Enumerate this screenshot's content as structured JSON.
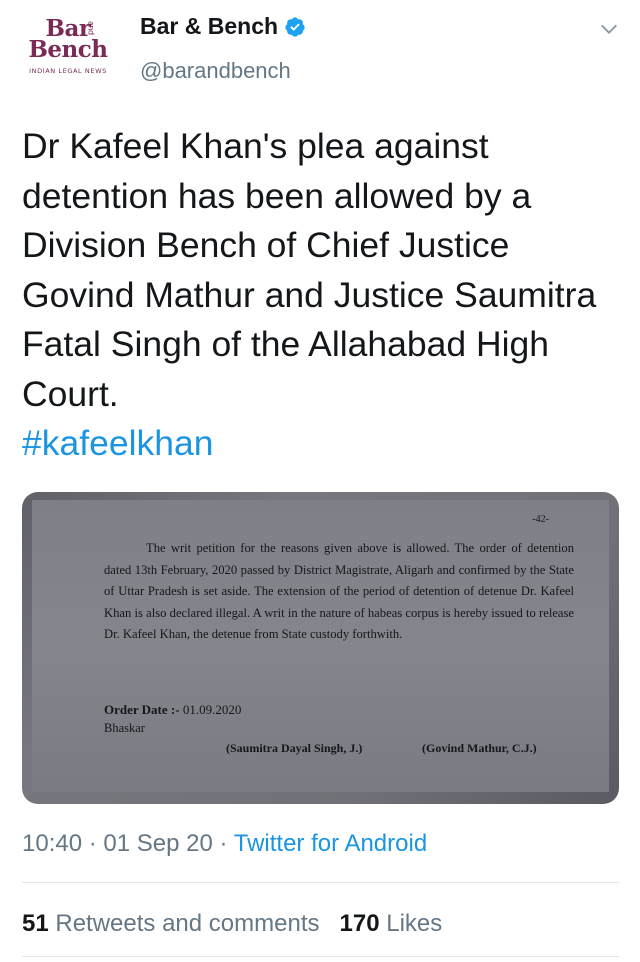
{
  "author": {
    "logo": {
      "line1": "Bar",
      "line2": "Bench",
      "and": "and",
      "tagline": "INDIAN LEGAL NEWS"
    },
    "display_name": "Bar & Bench",
    "handle": "@barandbench"
  },
  "tweet": {
    "text": "Dr Kafeel Khan's plea against detention has been allowed by a Division Bench of Chief Justice Govind Mathur and Justice Saumitra Fatal Singh of the Allahabad High Court.",
    "hashtag": "#kafeelkhan"
  },
  "media": {
    "page_number": "-42-",
    "paragraph": "The writ petition for the reasons given above is allowed. The order of detention dated 13th February, 2020 passed by District Magistrate, Aligarh and confirmed by the State of Uttar Pradesh is set aside. The extension of the period of detention of detenue Dr. Kafeel Khan is also declared illegal. A writ in the nature of habeas corpus is hereby issued to release Dr. Kafeel Khan, the detenue from State custody forthwith.",
    "order_date_label": "Order Date :-",
    "order_date": "01.09.2020",
    "clerk": "Bhaskar",
    "signature_1": "(Saumitra Dayal Singh, J.)",
    "signature_2": "(Govind Mathur, C.J.)"
  },
  "meta": {
    "time": "10:40",
    "separator": "·",
    "date": "01 Sep 20",
    "source": "Twitter for Android"
  },
  "stats": {
    "retweets_count": "51",
    "retweets_label": "Retweets and comments",
    "likes_count": "170",
    "likes_label": "Likes"
  },
  "colors": {
    "accent": "#1b95e0",
    "secondary": "#657786",
    "logo": "#7a2a55"
  },
  "icons": {
    "verified": "verified-badge-icon",
    "more": "chevron-down-icon"
  }
}
